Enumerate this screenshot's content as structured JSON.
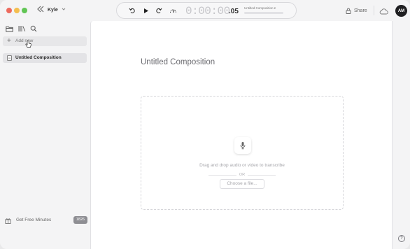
{
  "titlebar": {
    "workspace_name": "Kyle",
    "share_label": "Share",
    "avatar_initials": "AM"
  },
  "transport": {
    "timecode_main": "0:00:00",
    "timecode_frac": ".05",
    "composition_name": "Untitled Composition ▾"
  },
  "sidebar": {
    "add_new_label": "Add new",
    "documents": [
      {
        "label": "Untitled Composition"
      }
    ],
    "free_minutes_label": "Get Free Minutes",
    "minutes_badge": "1826"
  },
  "main": {
    "title": "Untitled Composition",
    "drop_hint": "Drag and drop audio or video to transcribe",
    "or_text": "OR",
    "choose_file_label": "Choose a file..."
  },
  "help": {
    "label": "?"
  },
  "colors": {
    "traffic_red": "#ed6a5e",
    "traffic_yellow": "#f4be4f",
    "traffic_green": "#61c554",
    "avatar_bg": "#1f1f21",
    "badge_bg": "#8e8e93"
  }
}
